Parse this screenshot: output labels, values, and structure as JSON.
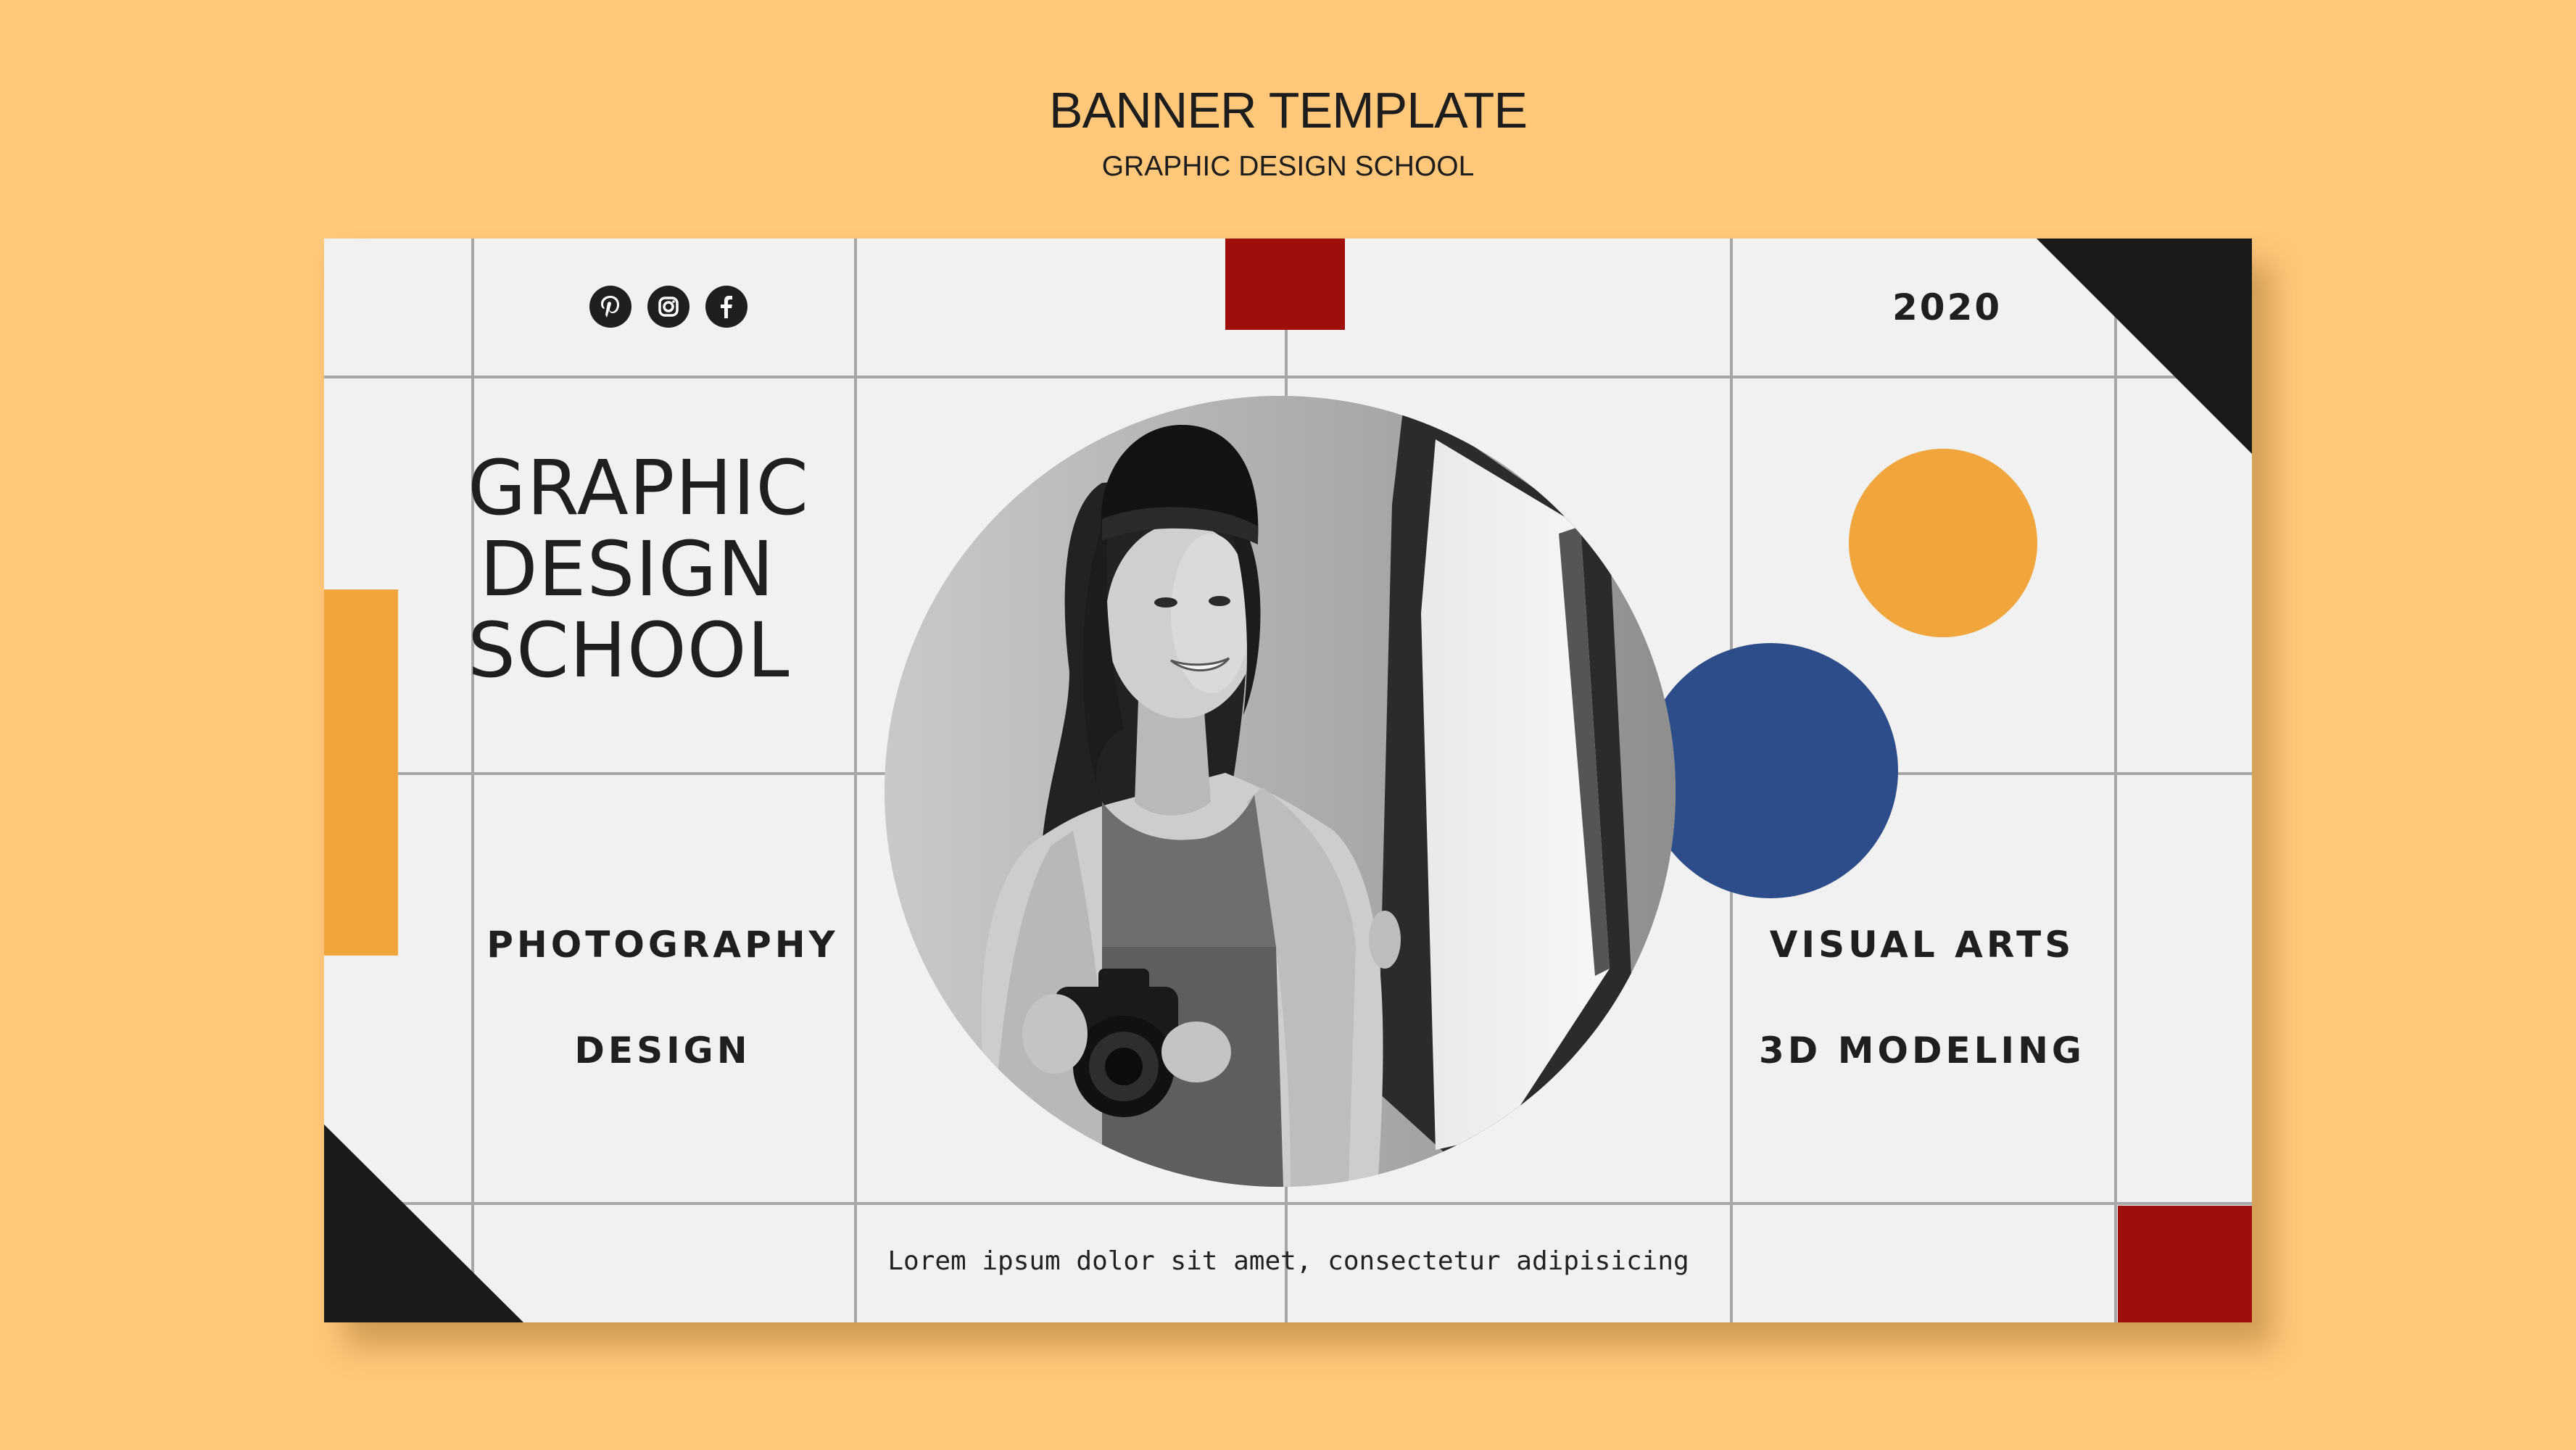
{
  "header": {
    "title": "BANNER TEMPLATE",
    "subtitle": "GRAPHIC DESIGN SCHOOL"
  },
  "banner": {
    "social_icons": [
      "pinterest-icon",
      "instagram-icon",
      "facebook-icon"
    ],
    "year": "2020",
    "title_lines": [
      "GRAPHIC",
      "DESIGN",
      "SCHOOL"
    ],
    "left_courses": [
      "PHOTOGRAPHY",
      "DESIGN"
    ],
    "right_courses": [
      "VISUAL ARTS",
      "3D MODELING"
    ],
    "footer_text": "Lorem ipsum dolor sit amet, consectetur adipisicing",
    "photo_subject": "smiling-woman-with-camera-photo"
  },
  "colors": {
    "page_background": "#ffc77a",
    "banner_background": "#f1f1f1",
    "grid_lines": "#a7a7a7",
    "accent_red": "#a00e0b",
    "accent_orange": "#f0a63c",
    "accent_blue": "#2d4c8a",
    "accent_black": "#1a1a1a"
  }
}
